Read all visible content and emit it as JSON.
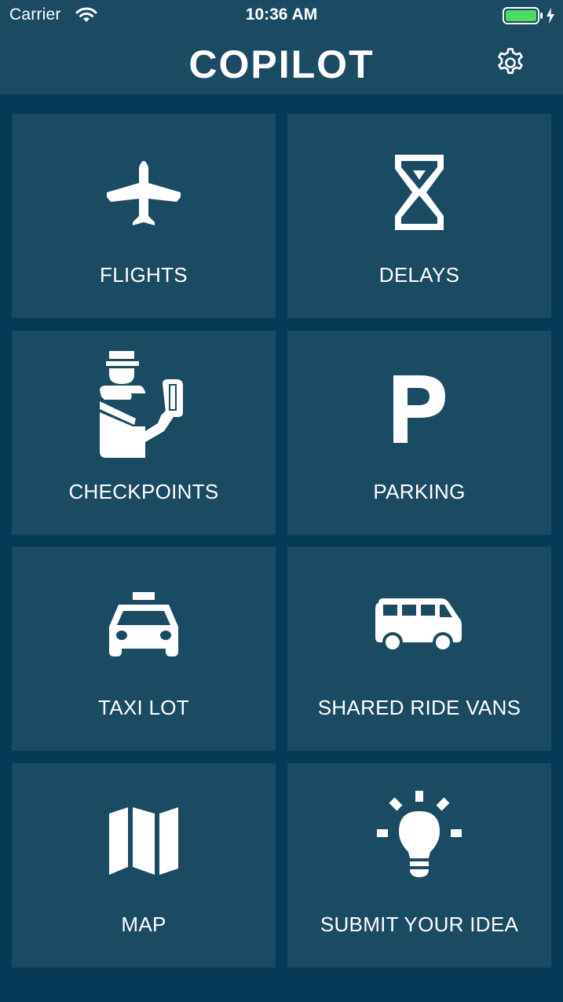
{
  "status_bar": {
    "carrier": "Carrier",
    "time": "10:36 AM",
    "battery_color": "#4cd964"
  },
  "header": {
    "title": "COPILOT",
    "settings_icon": "gear-icon"
  },
  "colors": {
    "background": "#063b57",
    "tile": "#1b4a63",
    "text": "#ffffff"
  },
  "tiles": [
    {
      "label": "FLIGHTS",
      "icon": "airplane-icon"
    },
    {
      "label": "DELAYS",
      "icon": "hourglass-icon"
    },
    {
      "label": "CHECKPOINTS",
      "icon": "security-officer-icon"
    },
    {
      "label": "PARKING",
      "icon": "parking-icon"
    },
    {
      "label": "TAXI LOT",
      "icon": "taxi-icon"
    },
    {
      "label": "SHARED RIDE VANS",
      "icon": "van-icon"
    },
    {
      "label": "MAP",
      "icon": "map-icon"
    },
    {
      "label": "SUBMIT YOUR IDEA",
      "icon": "lightbulb-icon"
    }
  ]
}
